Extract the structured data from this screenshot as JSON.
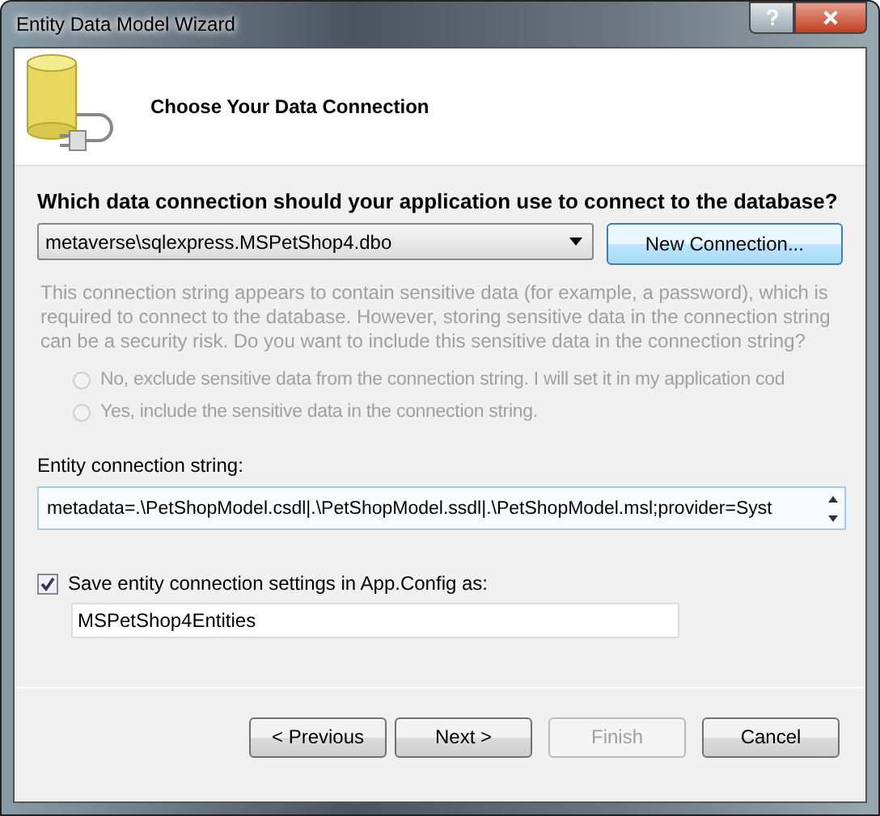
{
  "window": {
    "title": "Entity Data Model Wizard"
  },
  "header": {
    "title": "Choose Your Data Connection"
  },
  "question": "Which data connection should your application use to connect to the database?",
  "connection_dropdown": {
    "value": "metaverse\\sqlexpress.MSPetShop4.dbo"
  },
  "new_connection_button": "New Connection...",
  "sensitive_note": {
    "text": "This connection string appears to contain sensitive data (for example, a password), which is required to connect to the database.  However, storing sensitive data in the connection string can be a security risk. Do you want to include this sensitive data in the connection string?",
    "disabled": true
  },
  "sensitive_options": [
    {
      "label": "No, exclude sensitive data from the connection string. I will set it in my application cod",
      "selected": false,
      "disabled": true
    },
    {
      "label": "Yes, include the sensitive data in the connection string.",
      "selected": false,
      "disabled": true
    }
  ],
  "entity_connection_string": {
    "label": "Entity connection string:",
    "value": "metadata=.\\PetShopModel.csdl|.\\PetShopModel.ssdl|.\\PetShopModel.msl;provider=Syst"
  },
  "save_settings": {
    "label": "Save entity connection settings in App.Config as:",
    "checked": true,
    "value": "MSPetShop4Entities"
  },
  "buttons": [
    {
      "label": "< Previous",
      "disabled": false
    },
    {
      "label": "Next >",
      "disabled": false
    },
    {
      "label": "Finish",
      "disabled": true
    },
    {
      "label": "Cancel",
      "disabled": false
    }
  ]
}
